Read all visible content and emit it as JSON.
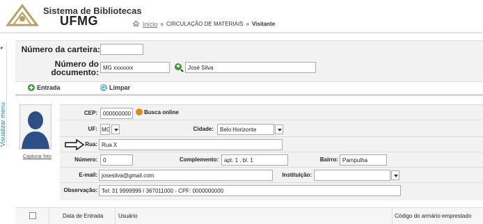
{
  "header": {
    "title": "Sistema de Bibliotecas",
    "subtitle": "UFMG",
    "breadcrumb": {
      "home": "Início",
      "sep1": "»",
      "section": "CIRCULAÇÃO DE MATERIAIS",
      "sep2": "»",
      "current": "Visitante"
    }
  },
  "sidebar": {
    "toggle_label": "Visualizar menu",
    "arrow": "▸"
  },
  "search": {
    "card_label": "Número da carteira:",
    "card_value": "",
    "doc_label_1": "Número do",
    "doc_label_2": "documento:",
    "doc_value": "MG xxxxxxx",
    "name_value": "José Silva"
  },
  "actions": {
    "entry": "Entrada",
    "clear": "Limpar"
  },
  "photo": {
    "capture_label": "Capturar foto"
  },
  "form": {
    "cep_label": "CEP:",
    "cep_value": "000000000",
    "cep_search": "Busca online",
    "uf_label": "UF:",
    "uf_value": "MG",
    "city_label": "Cidade:",
    "city_value": "Belo Horizonte",
    "street_label": "Rua:",
    "street_value": "Rua X",
    "number_label": "Número:",
    "number_value": "0",
    "complement_label": "Complemento:",
    "complement_value": "apt. 1 , bl. 1",
    "district_label": "Bairro:",
    "district_value": "Pampulha",
    "email_label": "E-mail:",
    "email_value": "josesilva@gmail.com",
    "institution_label": "Instituição:",
    "institution_value": "",
    "note_label": "Observação:",
    "note_value": "Tel: 31 9999999 / 367011000 - CPF: 0000000000"
  },
  "table": {
    "columns": [
      "Data de Entrada",
      "Usuário",
      "Código do armário emprestado"
    ]
  },
  "colors": {
    "accent_link": "#2a7fb0",
    "entry_icon": "#3a9a3a",
    "search_icon": "#5ba7d6",
    "cep_icon": "#e08a1e",
    "avatar": "#2d4f86"
  }
}
